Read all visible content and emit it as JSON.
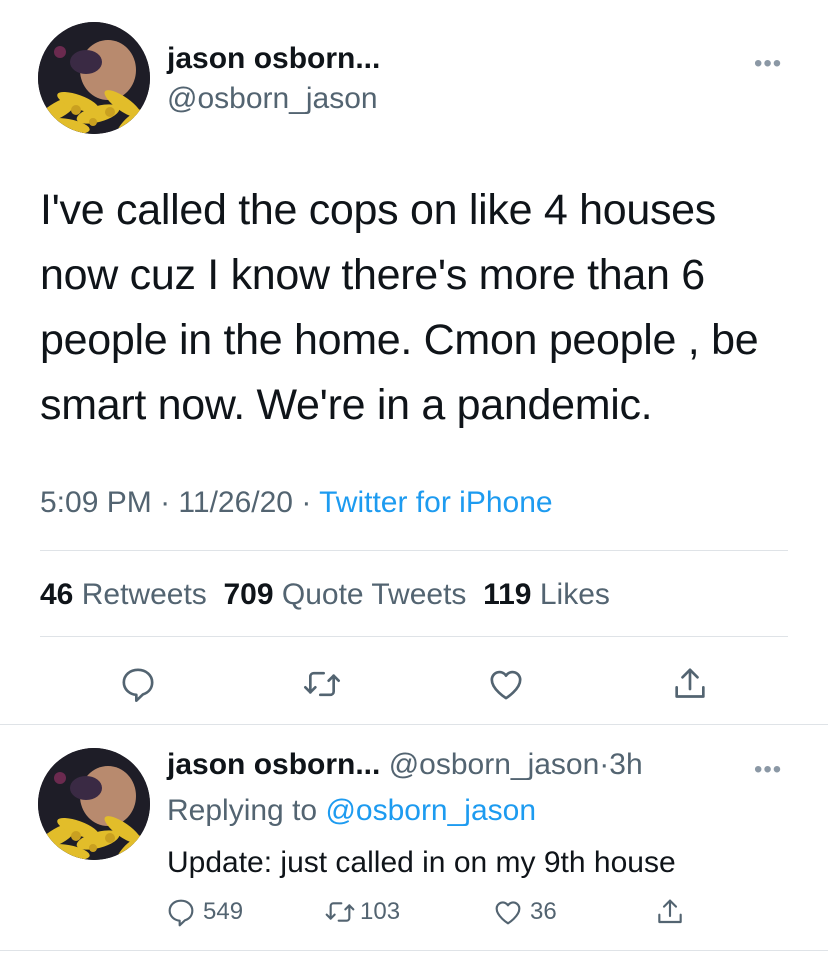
{
  "main_tweet": {
    "author_name": "jason osborn...",
    "author_handle": "@osborn_jason",
    "more_label": "•••",
    "text_lines": [
      "I've called the cops on like 4 houses",
      "now cuz I know there's more than 6",
      "people in the home. Cmon people , be",
      "smart now. We're in a pandemic."
    ],
    "time": "5:09 PM",
    "sep": "·",
    "date": "11/26/20",
    "source": "Twitter for iPhone",
    "stats": {
      "retweets_count": "46",
      "retweets_label": "Retweets",
      "quotes_count": "709",
      "quotes_label": "Quote Tweets",
      "likes_count": "119",
      "likes_label": "Likes"
    },
    "actions": [
      "reply-icon",
      "retweet-icon",
      "like-icon",
      "share-icon"
    ]
  },
  "reply_tweet": {
    "author_name": "jason osborn...",
    "author_handle": "@osborn_jason",
    "sep": "·",
    "time_ago": "3h",
    "more_label": "•••",
    "replying_prefix": "Replying to",
    "replying_handle": "@osborn_jason",
    "text": "Update: just called in on my 9th house",
    "replies": "549",
    "retweets": "103",
    "likes": "36"
  },
  "colors": {
    "accent": "#1d9bf0",
    "secondary_text": "#536471",
    "divider": "#dfe3e7"
  }
}
